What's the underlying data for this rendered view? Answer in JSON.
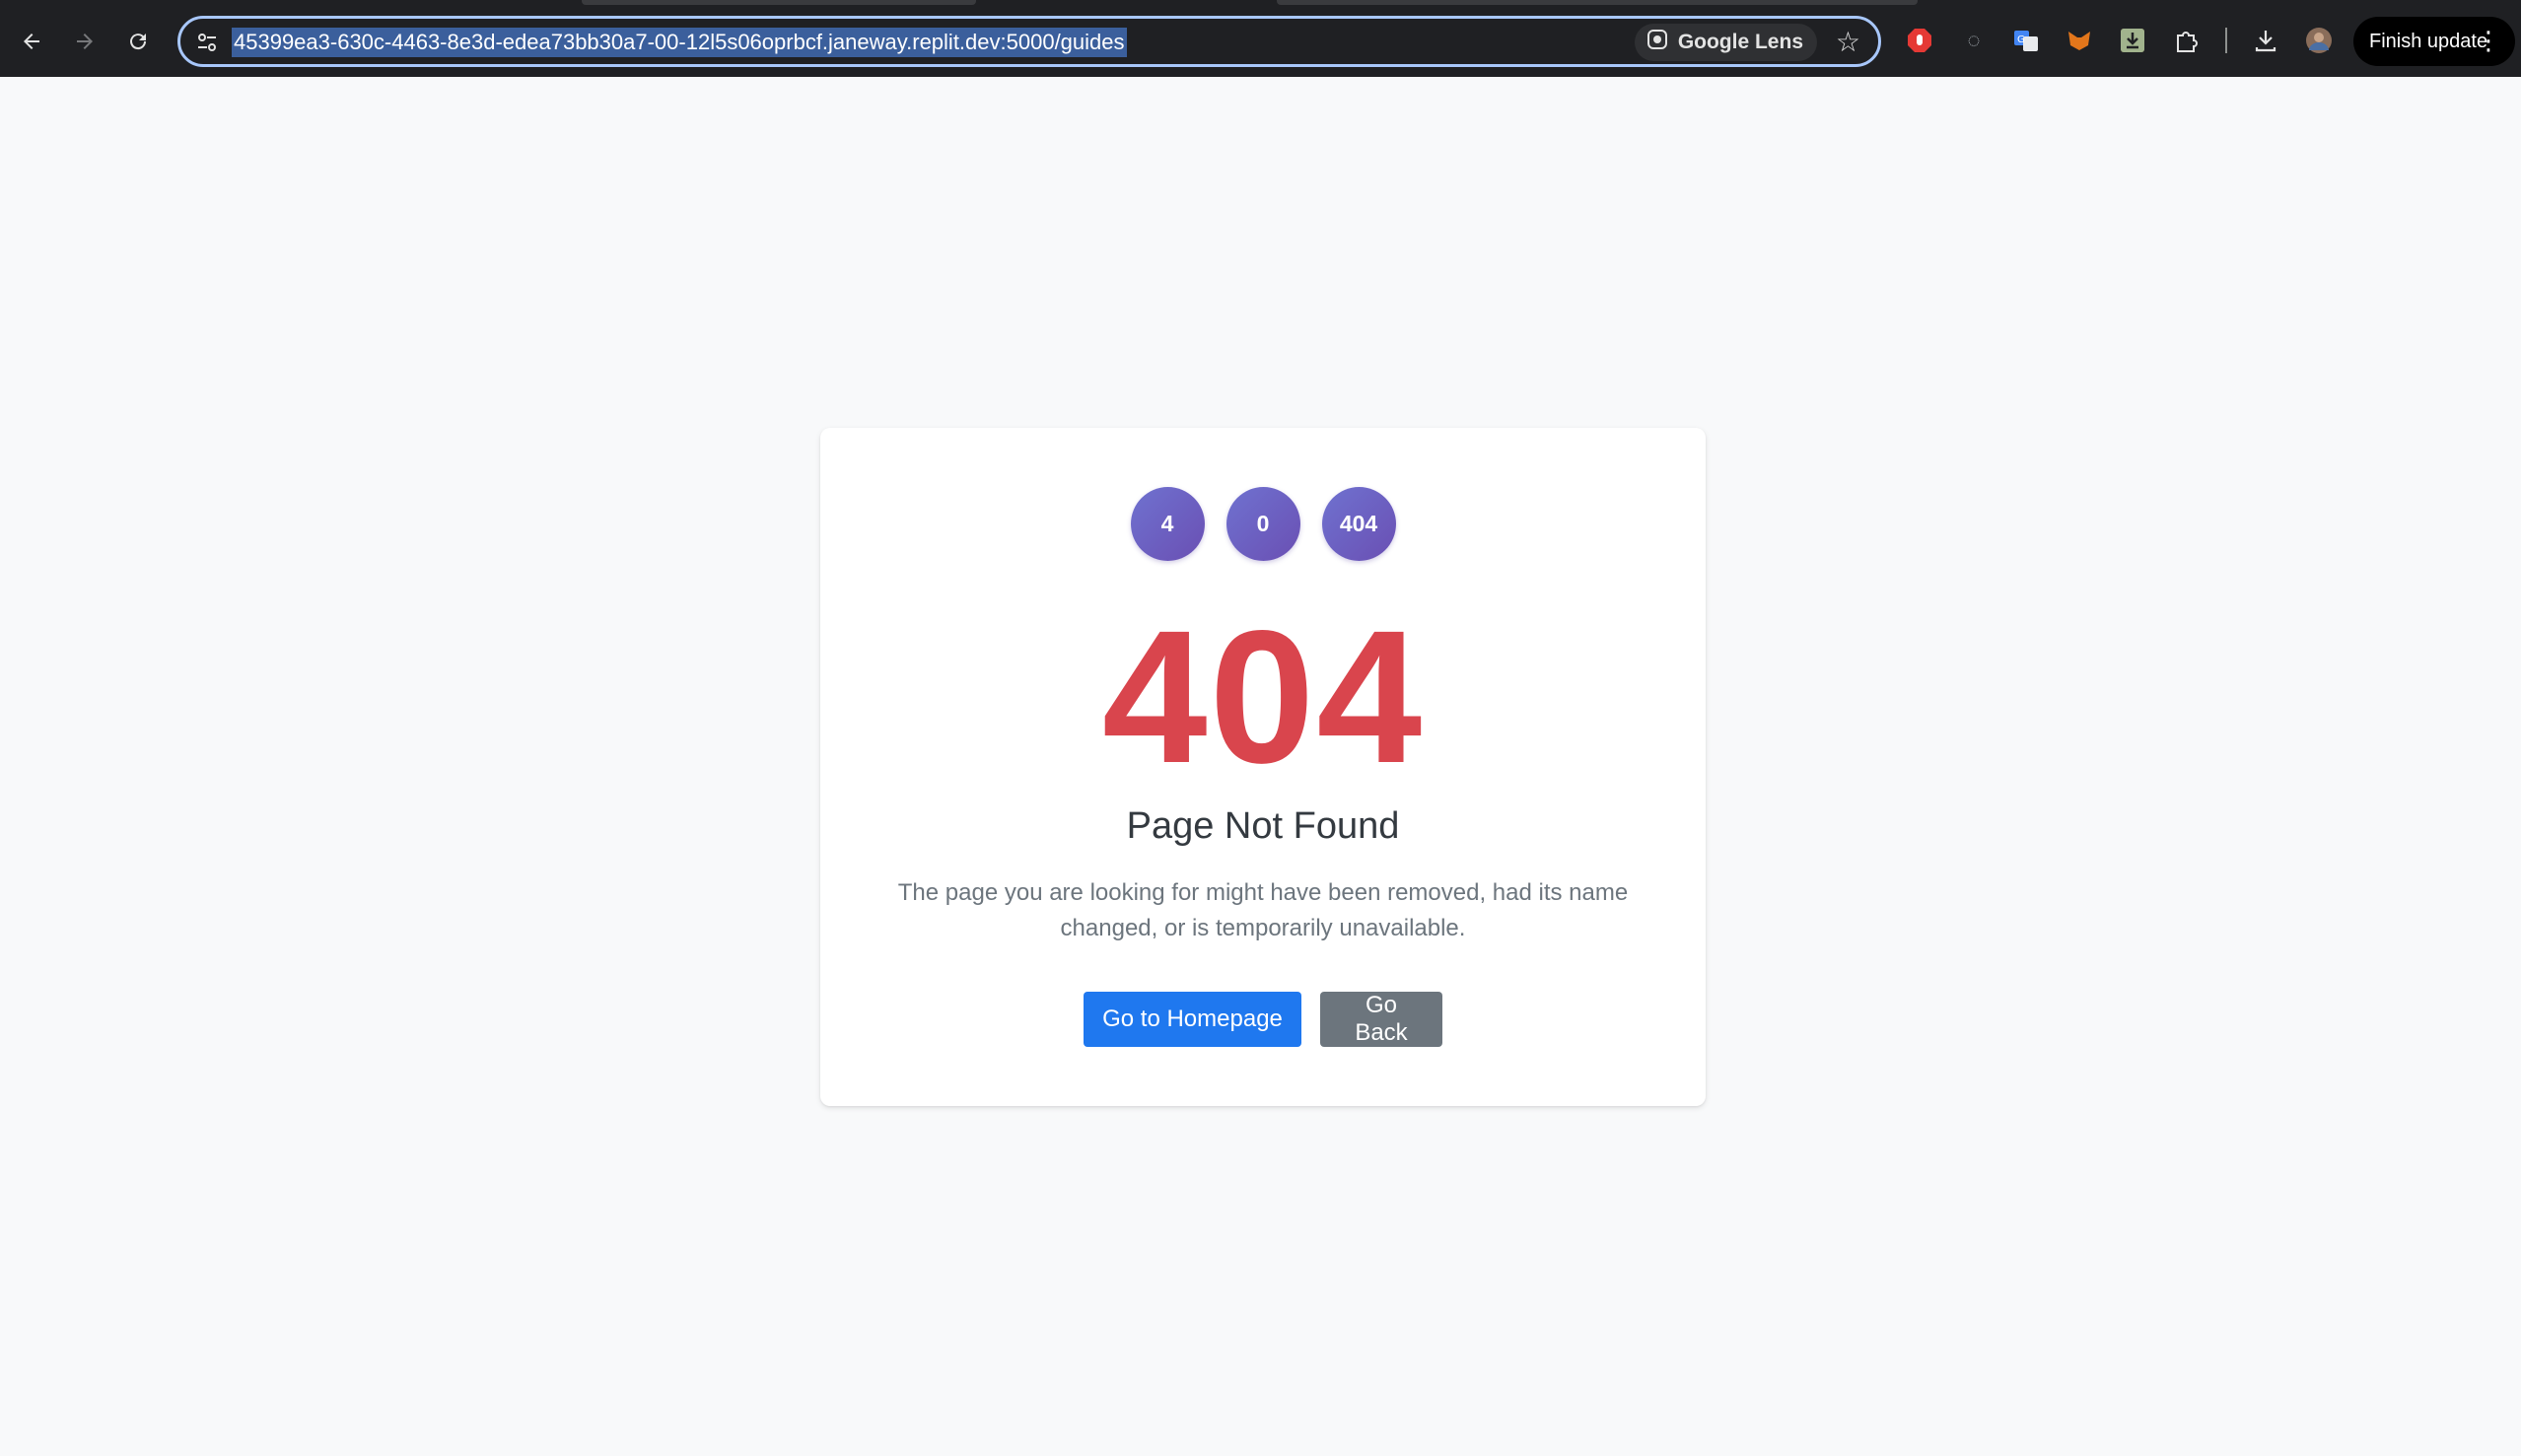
{
  "browser": {
    "url": "45399ea3-630c-4463-8e3d-edea73bb30a7-00-12l5s06oprbcf.janeway.replit.dev:5000/guides",
    "lens_label": "Google Lens",
    "finish_update_label": "Finish update",
    "icons": [
      "back-arrow-icon",
      "forward-arrow-icon",
      "reload-icon",
      "site-info-icon",
      "google-lens-icon",
      "bookmark-star-icon",
      "extension-icons",
      "downloads-icon",
      "profile-avatar",
      "kebab-menu-icon"
    ]
  },
  "page": {
    "circles": [
      "4",
      "0",
      "404"
    ],
    "code": "404",
    "title": "Page Not Found",
    "description": "The page you are looking for might have been removed, had its name changed, or is temporarily unavailable.",
    "primary_button": "Go to Homepage",
    "secondary_button": "Go Back"
  },
  "colors": {
    "code": "#d9454d",
    "primary": "#1f78ef",
    "secondary": "#6c757d",
    "circle_gradient_start": "#6f72d0",
    "circle_gradient_end": "#6a4fb3",
    "page_bg": "#f8f9fa"
  }
}
